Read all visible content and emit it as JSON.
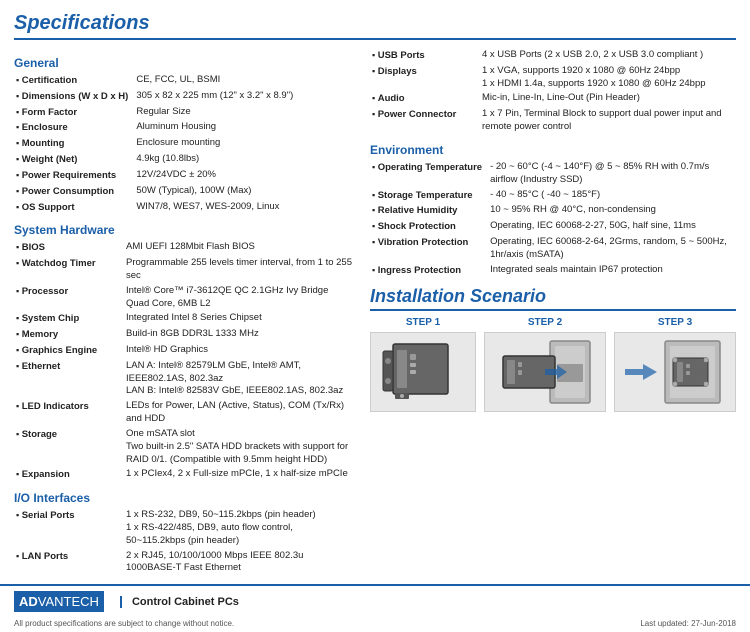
{
  "title": "Specifications",
  "left": {
    "general": {
      "title": "General",
      "items": [
        {
          "label": "Certification",
          "value": "CE, FCC, UL, BSMI"
        },
        {
          "label": "Dimensions (W x D x H)",
          "value": "305 x 82 x 225 mm (12\" x 3.2\" x 8.9\")"
        },
        {
          "label": "Form Factor",
          "value": "Regular Size"
        },
        {
          "label": "Enclosure",
          "value": "Aluminum Housing"
        },
        {
          "label": "Mounting",
          "value": "Enclosure mounting"
        },
        {
          "label": "Weight (Net)",
          "value": "4.9kg (10.8lbs)"
        },
        {
          "label": "Power Requirements",
          "value": "12V/24VDC ± 20%"
        },
        {
          "label": "Power Consumption",
          "value": "50W (Typical), 100W (Max)"
        },
        {
          "label": "OS Support",
          "value": "WIN7/8, WES7, WES-2009, Linux"
        }
      ]
    },
    "system_hardware": {
      "title": "System Hardware",
      "items": [
        {
          "label": "BIOS",
          "value": "AMI UEFI 128Mbit Flash BIOS"
        },
        {
          "label": "Watchdog Timer",
          "value": "Programmable 255 levels timer interval, from 1 to 255 sec"
        },
        {
          "label": "Processor",
          "value": "Intel® Core™ i7-3612QE QC 2.1GHz Ivy Bridge Quad Core, 6MB L2"
        },
        {
          "label": "System Chip",
          "value": "Integrated Intel 8 Series Chipset"
        },
        {
          "label": "Memory",
          "value": "Build-in 8GB DDR3L 1333 MHz"
        },
        {
          "label": "Graphics Engine",
          "value": "Intel® HD Graphics"
        },
        {
          "label": "Ethernet",
          "value": "LAN A: Intel® 82579LM GbE, Intel® AMT, IEEE802.1AS, 802.3az\nLAN B: Intel® 82583V GbE, IEEE802.1AS, 802.3az"
        },
        {
          "label": "LED Indicators",
          "value": "LEDs for Power, LAN (Active, Status), COM (Tx/Rx) and HDD"
        },
        {
          "label": "Storage",
          "value": "One mSATA slot\nTwo built-in 2.5\" SATA HDD brackets with support for RAID 0/1. (Compatible with 9.5mm height HDD)"
        },
        {
          "label": "Expansion",
          "value": "1 x PCIex4, 2 x Full-size mPCIe, 1 x half-size mPCIe"
        }
      ]
    },
    "io_interfaces": {
      "title": "I/O Interfaces",
      "items": [
        {
          "label": "Serial Ports",
          "value": "1 x RS-232, DB9, 50~115.2kbps (pin header)\n1 x RS-422/485, DB9, auto flow control, 50~115.2kbps (pin header)"
        },
        {
          "label": "LAN Ports",
          "value": "2 x RJ45, 10/100/1000 Mbps IEEE 802.3u\n1000BASE-T Fast Ethernet"
        }
      ]
    }
  },
  "right": {
    "io_continued": {
      "items": [
        {
          "label": "USB Ports",
          "value": "4 x USB Ports (2 x USB 2.0, 2 x USB 3.0 compliant )"
        },
        {
          "label": "Displays",
          "value": "1 x VGA, supports 1920 x 1080 @ 60Hz 24bpp\n1 x HDMI 1.4a, supports 1920 x 1080 @ 60Hz 24bpp"
        },
        {
          "label": "Audio",
          "value": "Mic-in, Line-In, Line-Out (Pin Header)"
        },
        {
          "label": "Power Connector",
          "value": "1 x 7 Pin, Terminal Block to support dual power input and remote power control"
        }
      ]
    },
    "environment": {
      "title": "Environment",
      "items": [
        {
          "label": "Operating Temperature",
          "value": "- 20 ~ 60°C (-4 ~ 140°F) @ 5 ~ 85% RH with 0.7m/s airflow (Industry SSD)"
        },
        {
          "label": "Storage Temperature",
          "value": "- 40 ~ 85°C ( -40 ~ 185°F)"
        },
        {
          "label": "Relative Humidity",
          "value": "10 ~ 95% RH @ 40°C, non-condensing"
        },
        {
          "label": "Shock Protection",
          "value": "Operating, IEC 60068-2-27, 50G, half sine, 11ms"
        },
        {
          "label": "Vibration Protection",
          "value": "Operating, IEC 60068-2-64, 2Grms, random, 5 ~ 500Hz, 1hr/axis (mSATA)"
        },
        {
          "label": "Ingress Protection",
          "value": "Integrated seals maintain IP67 protection"
        }
      ]
    },
    "installation": {
      "title": "Installation Scenario",
      "steps": [
        {
          "label": "STEP 1"
        },
        {
          "label": "STEP 2"
        },
        {
          "label": "STEP 3"
        }
      ]
    }
  },
  "footer": {
    "logo_box": "AD|ANTECH",
    "logo_adv": "AD",
    "logo_antech": "VANTECH",
    "product": "Control Cabinet PCs",
    "notice": "All product specifications are subject to change without notice.",
    "date": "Last updated: 27-Jun-2018"
  }
}
